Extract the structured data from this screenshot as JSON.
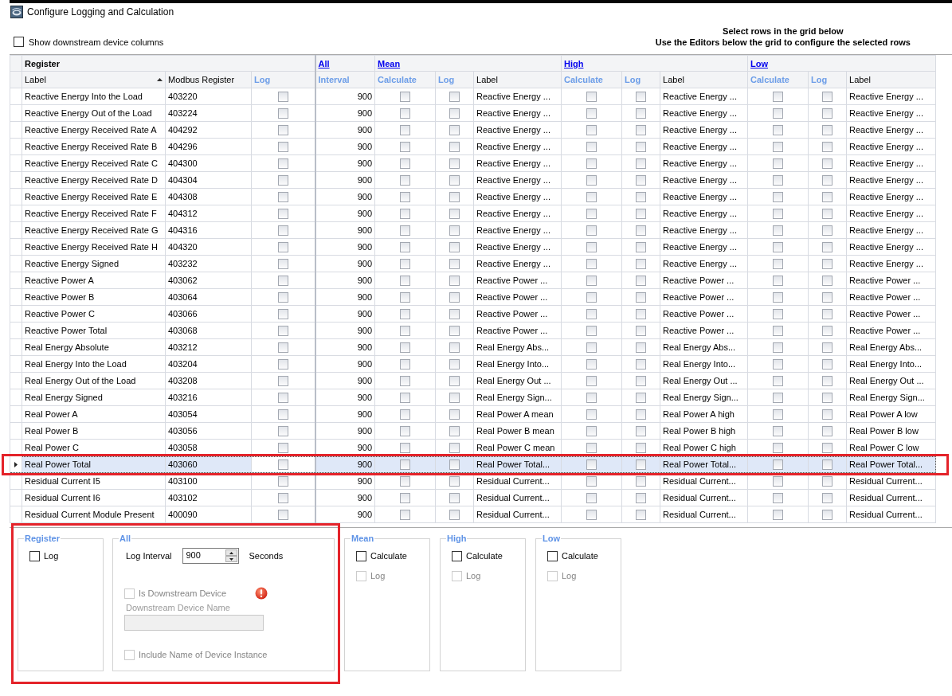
{
  "window": {
    "title": "Configure Logging and Calculation"
  },
  "show_downstream_columns": {
    "label": "Show downstream device columns",
    "checked": false
  },
  "instructions": [
    "Select rows in the grid below",
    "Use the Editors below the grid to configure the selected rows"
  ],
  "table": {
    "bands": [
      {
        "title": "Register",
        "kind": "plain",
        "columns": [
          {
            "title": "Label",
            "editable": false,
            "sorted": true
          },
          {
            "title": "Modbus Register",
            "editable": false,
            "sorted": false
          },
          {
            "title": "Log",
            "editable": true,
            "sorted": false
          }
        ]
      },
      {
        "title": "All",
        "kind": "link",
        "columns": [
          {
            "title": "Interval",
            "editable": true,
            "sorted": false
          }
        ]
      },
      {
        "title": "Mean",
        "kind": "link",
        "columns": [
          {
            "title": "Calculate",
            "editable": true,
            "sorted": false
          },
          {
            "title": "Log",
            "editable": true,
            "sorted": false
          },
          {
            "title": "Label",
            "editable": false,
            "sorted": false
          }
        ]
      },
      {
        "title": "High",
        "kind": "link",
        "columns": [
          {
            "title": "Calculate",
            "editable": true,
            "sorted": false
          },
          {
            "title": "Log",
            "editable": true,
            "sorted": false
          },
          {
            "title": "Label",
            "editable": false,
            "sorted": false
          }
        ]
      },
      {
        "title": "Low",
        "kind": "link",
        "columns": [
          {
            "title": "Calculate",
            "editable": true,
            "sorted": false
          },
          {
            "title": "Log",
            "editable": true,
            "sorted": false
          },
          {
            "title": "Label",
            "editable": false,
            "sorted": false
          }
        ]
      }
    ],
    "rows": [
      {
        "label": "Reactive Energy Into the Load",
        "modbus_register": "403220",
        "log": false,
        "interval": "900",
        "mean": {
          "calculate": false,
          "log": false,
          "label": "Reactive Energy ..."
        },
        "high": {
          "calculate": false,
          "log": false,
          "label": "Reactive Energy ..."
        },
        "low": {
          "calculate": false,
          "log": false,
          "label": "Reactive Energy ..."
        },
        "selected": false,
        "highlighted": false
      },
      {
        "label": "Reactive Energy Out of the Load",
        "modbus_register": "403224",
        "log": false,
        "interval": "900",
        "mean": {
          "calculate": false,
          "log": false,
          "label": "Reactive Energy ..."
        },
        "high": {
          "calculate": false,
          "log": false,
          "label": "Reactive Energy ..."
        },
        "low": {
          "calculate": false,
          "log": false,
          "label": "Reactive Energy ..."
        },
        "selected": false,
        "highlighted": false
      },
      {
        "label": "Reactive Energy Received Rate A",
        "modbus_register": "404292",
        "log": false,
        "interval": "900",
        "mean": {
          "calculate": false,
          "log": false,
          "label": "Reactive Energy ..."
        },
        "high": {
          "calculate": false,
          "log": false,
          "label": "Reactive Energy ..."
        },
        "low": {
          "calculate": false,
          "log": false,
          "label": "Reactive Energy ..."
        },
        "selected": false,
        "highlighted": false
      },
      {
        "label": "Reactive Energy Received Rate B",
        "modbus_register": "404296",
        "log": false,
        "interval": "900",
        "mean": {
          "calculate": false,
          "log": false,
          "label": "Reactive Energy ..."
        },
        "high": {
          "calculate": false,
          "log": false,
          "label": "Reactive Energy ..."
        },
        "low": {
          "calculate": false,
          "log": false,
          "label": "Reactive Energy ..."
        },
        "selected": false,
        "highlighted": false
      },
      {
        "label": "Reactive Energy Received Rate C",
        "modbus_register": "404300",
        "log": false,
        "interval": "900",
        "mean": {
          "calculate": false,
          "log": false,
          "label": "Reactive Energy ..."
        },
        "high": {
          "calculate": false,
          "log": false,
          "label": "Reactive Energy ..."
        },
        "low": {
          "calculate": false,
          "log": false,
          "label": "Reactive Energy ..."
        },
        "selected": false,
        "highlighted": false
      },
      {
        "label": "Reactive Energy Received Rate D",
        "modbus_register": "404304",
        "log": false,
        "interval": "900",
        "mean": {
          "calculate": false,
          "log": false,
          "label": "Reactive Energy ..."
        },
        "high": {
          "calculate": false,
          "log": false,
          "label": "Reactive Energy ..."
        },
        "low": {
          "calculate": false,
          "log": false,
          "label": "Reactive Energy ..."
        },
        "selected": false,
        "highlighted": false
      },
      {
        "label": "Reactive Energy Received Rate E",
        "modbus_register": "404308",
        "log": false,
        "interval": "900",
        "mean": {
          "calculate": false,
          "log": false,
          "label": "Reactive Energy ..."
        },
        "high": {
          "calculate": false,
          "log": false,
          "label": "Reactive Energy ..."
        },
        "low": {
          "calculate": false,
          "log": false,
          "label": "Reactive Energy ..."
        },
        "selected": false,
        "highlighted": false
      },
      {
        "label": "Reactive Energy Received Rate F",
        "modbus_register": "404312",
        "log": false,
        "interval": "900",
        "mean": {
          "calculate": false,
          "log": false,
          "label": "Reactive Energy ..."
        },
        "high": {
          "calculate": false,
          "log": false,
          "label": "Reactive Energy ..."
        },
        "low": {
          "calculate": false,
          "log": false,
          "label": "Reactive Energy ..."
        },
        "selected": false,
        "highlighted": false
      },
      {
        "label": "Reactive Energy Received Rate G",
        "modbus_register": "404316",
        "log": false,
        "interval": "900",
        "mean": {
          "calculate": false,
          "log": false,
          "label": "Reactive Energy ..."
        },
        "high": {
          "calculate": false,
          "log": false,
          "label": "Reactive Energy ..."
        },
        "low": {
          "calculate": false,
          "log": false,
          "label": "Reactive Energy ..."
        },
        "selected": false,
        "highlighted": false
      },
      {
        "label": "Reactive Energy Received Rate H",
        "modbus_register": "404320",
        "log": false,
        "interval": "900",
        "mean": {
          "calculate": false,
          "log": false,
          "label": "Reactive Energy ..."
        },
        "high": {
          "calculate": false,
          "log": false,
          "label": "Reactive Energy ..."
        },
        "low": {
          "calculate": false,
          "log": false,
          "label": "Reactive Energy ..."
        },
        "selected": false,
        "highlighted": false
      },
      {
        "label": "Reactive Energy Signed",
        "modbus_register": "403232",
        "log": false,
        "interval": "900",
        "mean": {
          "calculate": false,
          "log": false,
          "label": "Reactive Energy ..."
        },
        "high": {
          "calculate": false,
          "log": false,
          "label": "Reactive Energy ..."
        },
        "low": {
          "calculate": false,
          "log": false,
          "label": "Reactive Energy ..."
        },
        "selected": false,
        "highlighted": false
      },
      {
        "label": "Reactive Power A",
        "modbus_register": "403062",
        "log": false,
        "interval": "900",
        "mean": {
          "calculate": false,
          "log": false,
          "label": "Reactive Power ..."
        },
        "high": {
          "calculate": false,
          "log": false,
          "label": "Reactive Power ..."
        },
        "low": {
          "calculate": false,
          "log": false,
          "label": "Reactive Power ..."
        },
        "selected": false,
        "highlighted": false
      },
      {
        "label": "Reactive Power B",
        "modbus_register": "403064",
        "log": false,
        "interval": "900",
        "mean": {
          "calculate": false,
          "log": false,
          "label": "Reactive Power ..."
        },
        "high": {
          "calculate": false,
          "log": false,
          "label": "Reactive Power ..."
        },
        "low": {
          "calculate": false,
          "log": false,
          "label": "Reactive Power ..."
        },
        "selected": false,
        "highlighted": false
      },
      {
        "label": "Reactive Power C",
        "modbus_register": "403066",
        "log": false,
        "interval": "900",
        "mean": {
          "calculate": false,
          "log": false,
          "label": "Reactive Power ..."
        },
        "high": {
          "calculate": false,
          "log": false,
          "label": "Reactive Power ..."
        },
        "low": {
          "calculate": false,
          "log": false,
          "label": "Reactive Power ..."
        },
        "selected": false,
        "highlighted": false
      },
      {
        "label": "Reactive Power Total",
        "modbus_register": "403068",
        "log": false,
        "interval": "900",
        "mean": {
          "calculate": false,
          "log": false,
          "label": "Reactive Power ..."
        },
        "high": {
          "calculate": false,
          "log": false,
          "label": "Reactive Power ..."
        },
        "low": {
          "calculate": false,
          "log": false,
          "label": "Reactive Power ..."
        },
        "selected": false,
        "highlighted": false
      },
      {
        "label": "Real Energy Absolute",
        "modbus_register": "403212",
        "log": false,
        "interval": "900",
        "mean": {
          "calculate": false,
          "log": false,
          "label": "Real Energy Abs..."
        },
        "high": {
          "calculate": false,
          "log": false,
          "label": "Real Energy Abs..."
        },
        "low": {
          "calculate": false,
          "log": false,
          "label": "Real Energy Abs..."
        },
        "selected": false,
        "highlighted": false
      },
      {
        "label": "Real Energy Into the Load",
        "modbus_register": "403204",
        "log": false,
        "interval": "900",
        "mean": {
          "calculate": false,
          "log": false,
          "label": "Real Energy Into..."
        },
        "high": {
          "calculate": false,
          "log": false,
          "label": "Real Energy Into..."
        },
        "low": {
          "calculate": false,
          "log": false,
          "label": "Real Energy Into..."
        },
        "selected": false,
        "highlighted": false
      },
      {
        "label": "Real Energy Out of the Load",
        "modbus_register": "403208",
        "log": false,
        "interval": "900",
        "mean": {
          "calculate": false,
          "log": false,
          "label": "Real Energy Out ..."
        },
        "high": {
          "calculate": false,
          "log": false,
          "label": "Real Energy Out ..."
        },
        "low": {
          "calculate": false,
          "log": false,
          "label": "Real Energy Out ..."
        },
        "selected": false,
        "highlighted": false
      },
      {
        "label": "Real Energy Signed",
        "modbus_register": "403216",
        "log": false,
        "interval": "900",
        "mean": {
          "calculate": false,
          "log": false,
          "label": "Real Energy Sign..."
        },
        "high": {
          "calculate": false,
          "log": false,
          "label": "Real Energy Sign..."
        },
        "low": {
          "calculate": false,
          "log": false,
          "label": "Real Energy Sign..."
        },
        "selected": false,
        "highlighted": false
      },
      {
        "label": "Real Power A",
        "modbus_register": "403054",
        "log": false,
        "interval": "900",
        "mean": {
          "calculate": false,
          "log": false,
          "label": "Real Power A mean"
        },
        "high": {
          "calculate": false,
          "log": false,
          "label": "Real Power A high"
        },
        "low": {
          "calculate": false,
          "log": false,
          "label": "Real Power A low"
        },
        "selected": false,
        "highlighted": false
      },
      {
        "label": "Real Power B",
        "modbus_register": "403056",
        "log": false,
        "interval": "900",
        "mean": {
          "calculate": false,
          "log": false,
          "label": "Real Power B mean"
        },
        "high": {
          "calculate": false,
          "log": false,
          "label": "Real Power B high"
        },
        "low": {
          "calculate": false,
          "log": false,
          "label": "Real Power B low"
        },
        "selected": false,
        "highlighted": false
      },
      {
        "label": "Real Power C",
        "modbus_register": "403058",
        "log": false,
        "interval": "900",
        "mean": {
          "calculate": false,
          "log": false,
          "label": "Real Power C mean"
        },
        "high": {
          "calculate": false,
          "log": false,
          "label": "Real Power C high"
        },
        "low": {
          "calculate": false,
          "log": false,
          "label": "Real Power C low"
        },
        "selected": false,
        "highlighted": false
      },
      {
        "label": "Real Power Total",
        "modbus_register": "403060",
        "log": false,
        "interval": "900",
        "mean": {
          "calculate": false,
          "log": false,
          "label": "Real Power Total..."
        },
        "high": {
          "calculate": false,
          "log": false,
          "label": "Real Power Total..."
        },
        "low": {
          "calculate": false,
          "log": false,
          "label": "Real Power Total..."
        },
        "selected": true,
        "highlighted": true
      },
      {
        "label": "Residual Current I5",
        "modbus_register": "403100",
        "log": false,
        "interval": "900",
        "mean": {
          "calculate": false,
          "log": false,
          "label": "Residual Current..."
        },
        "high": {
          "calculate": false,
          "log": false,
          "label": "Residual Current..."
        },
        "low": {
          "calculate": false,
          "log": false,
          "label": "Residual Current..."
        },
        "selected": false,
        "highlighted": false
      },
      {
        "label": "Residual Current I6",
        "modbus_register": "403102",
        "log": false,
        "interval": "900",
        "mean": {
          "calculate": false,
          "log": false,
          "label": "Residual Current..."
        },
        "high": {
          "calculate": false,
          "log": false,
          "label": "Residual Current..."
        },
        "low": {
          "calculate": false,
          "log": false,
          "label": "Residual Current..."
        },
        "selected": false,
        "highlighted": false
      },
      {
        "label": "Residual Current Module Present",
        "modbus_register": "400090",
        "log": false,
        "interval": "900",
        "mean": {
          "calculate": false,
          "log": false,
          "label": "Residual Current..."
        },
        "high": {
          "calculate": false,
          "log": false,
          "label": "Residual Current..."
        },
        "low": {
          "calculate": false,
          "log": false,
          "label": "Residual Current..."
        },
        "selected": false,
        "highlighted": false
      }
    ]
  },
  "editors": [
    {
      "title": "Register",
      "framed": true,
      "controls": [
        {
          "kind": "checkbox",
          "label": "Log",
          "checked": false,
          "disabled": false
        }
      ]
    },
    {
      "title": "All",
      "framed": true,
      "controls": [
        {
          "kind": "spinner",
          "label": "Log Interval",
          "value": "900",
          "unit": "Seconds"
        },
        {
          "kind": "checkbox",
          "label": "Is Downstream Device",
          "checked": false,
          "disabled": true,
          "error": true
        },
        {
          "kind": "text_field",
          "label": "Downstream Device Name",
          "disabled": true
        },
        {
          "kind": "checkbox",
          "label": "Include Name of Device Instance",
          "checked": false,
          "disabled": true
        }
      ]
    },
    {
      "title": "Mean",
      "framed": false,
      "controls": [
        {
          "kind": "checkbox",
          "label": "Calculate",
          "checked": false,
          "disabled": false
        },
        {
          "kind": "checkbox",
          "label": "Log",
          "checked": false,
          "disabled": true
        }
      ]
    },
    {
      "title": "High",
      "framed": false,
      "controls": [
        {
          "kind": "checkbox",
          "label": "Calculate",
          "checked": false,
          "disabled": false
        },
        {
          "kind": "checkbox",
          "label": "Log",
          "checked": false,
          "disabled": true
        }
      ]
    },
    {
      "title": "Low",
      "framed": false,
      "controls": [
        {
          "kind": "checkbox",
          "label": "Calculate",
          "checked": false,
          "disabled": false
        },
        {
          "kind": "checkbox",
          "label": "Log",
          "checked": false,
          "disabled": true
        }
      ]
    }
  ]
}
